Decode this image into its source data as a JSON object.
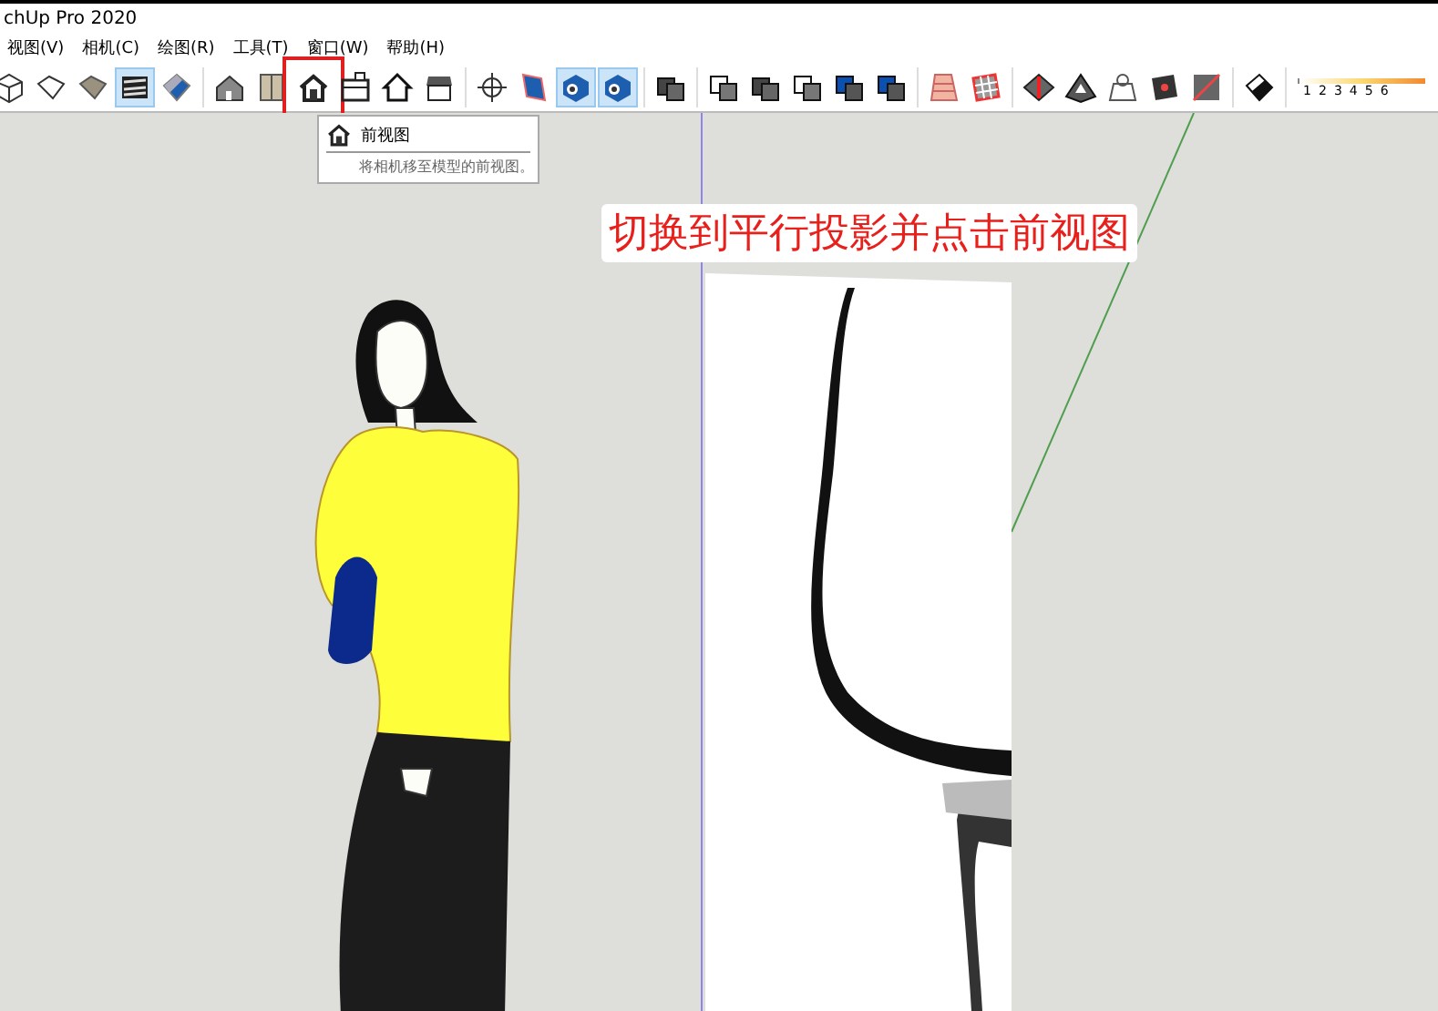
{
  "window": {
    "title": "chUp Pro 2020"
  },
  "menu": [
    "视图(V)",
    "相机(C)",
    "绘图(R)",
    "工具(T)",
    "窗口(W)",
    "帮助(H)"
  ],
  "toolbar": [
    [
      {
        "kind": "wire-box",
        "selected": false
      },
      {
        "kind": "outline-box",
        "selected": false
      },
      {
        "kind": "shaded-box",
        "selected": false
      },
      {
        "kind": "striped-box",
        "selected": true
      },
      {
        "kind": "blue-box",
        "selected": false
      }
    ],
    [
      {
        "kind": "iso-house",
        "selected": false
      },
      {
        "kind": "side-box",
        "selected": false
      },
      {
        "kind": "front-house",
        "selected": false,
        "marked": true
      },
      {
        "kind": "right-house",
        "selected": false
      },
      {
        "kind": "outline-house",
        "selected": false
      },
      {
        "kind": "back-house",
        "selected": false
      }
    ],
    [
      {
        "kind": "orbit",
        "selected": false
      },
      {
        "kind": "blue-section",
        "selected": false
      },
      {
        "kind": "blue-cube",
        "selected": true
      },
      {
        "kind": "blue-cube",
        "selected": true
      }
    ],
    [
      {
        "kind": "dark-cubes",
        "selected": false
      }
    ],
    [
      {
        "kind": "layered-cubes",
        "selected": false
      },
      {
        "kind": "dark-cubes",
        "selected": false
      },
      {
        "kind": "layered-cubes",
        "selected": false
      },
      {
        "kind": "blue-layers",
        "selected": false
      },
      {
        "kind": "blue-layers",
        "selected": false
      }
    ],
    [
      {
        "kind": "pink-mesh",
        "selected": false
      },
      {
        "kind": "grid-mesh",
        "selected": false
      }
    ],
    [
      {
        "kind": "diamond",
        "selected": false
      },
      {
        "kind": "terrain",
        "selected": false
      },
      {
        "kind": "bag",
        "selected": false
      },
      {
        "kind": "square-dot",
        "selected": false
      },
      {
        "kind": "pyramid",
        "selected": false
      }
    ],
    [
      {
        "kind": "eraser",
        "selected": false
      }
    ]
  ],
  "scale": [
    "1",
    "2",
    "3",
    "4",
    "5",
    "6"
  ],
  "tooltip": {
    "title": "前视图",
    "description": "将相机移至模型的前视图。"
  },
  "caption": "切换到平行投影并点击前视图"
}
